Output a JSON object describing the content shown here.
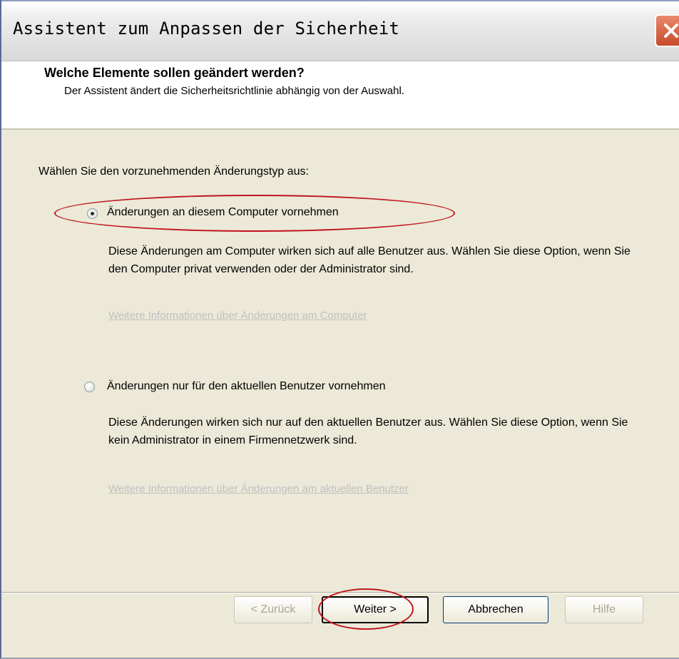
{
  "window": {
    "title": "Assistent zum Anpassen der Sicherheit"
  },
  "header": {
    "title": "Welche Elemente sollen geändert werden?",
    "subtitle": "Der Assistent ändert die Sicherheitsrichtlinie abhängig von der Auswahl."
  },
  "prompt": "Wählen Sie den vorzunehmenden Änderungstyp aus:",
  "options": [
    {
      "label": "Änderungen an diesem Computer vornehmen",
      "checked": true,
      "description": "Diese Änderungen am Computer wirken sich auf alle Benutzer aus. Wählen Sie diese Option, wenn Sie den Computer privat verwenden oder der Administrator sind.",
      "link": "Weitere Informationen über Änderungen am Computer"
    },
    {
      "label": "Änderungen nur für den aktuellen Benutzer vornehmen",
      "checked": false,
      "description": "Diese Änderungen wirken sich nur auf den aktuellen Benutzer aus. Wählen Sie diese Option, wenn Sie kein Administrator in einem Firmennetzwerk sind.",
      "link": "Weitere Informationen über Änderungen am aktuellen Benutzer"
    }
  ],
  "buttons": {
    "back": "< Zurück",
    "next": "Weiter >",
    "cancel": "Abbrechen",
    "help": "Hilfe"
  },
  "icons": {
    "close": "close-icon"
  },
  "colors": {
    "highlight_ellipse": "#c0141c",
    "disabled_text": "#a8a699"
  }
}
